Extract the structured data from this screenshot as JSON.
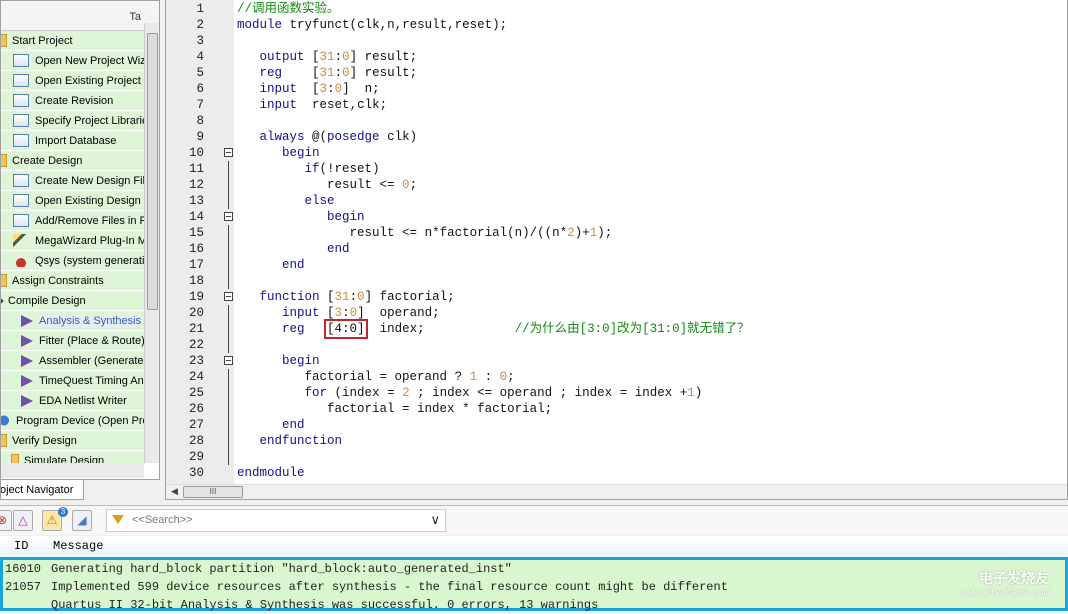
{
  "nav": {
    "header": "Ta",
    "items": [
      {
        "label": "Start Project",
        "level": 0,
        "icon": "folder"
      },
      {
        "label": "Open New Project Wizard",
        "level": 1,
        "icon": "page"
      },
      {
        "label": "Open Existing Project",
        "level": 1,
        "icon": "page"
      },
      {
        "label": "Create Revision",
        "level": 1,
        "icon": "page"
      },
      {
        "label": "Specify Project Libraries",
        "level": 1,
        "icon": "page"
      },
      {
        "label": "Import Database",
        "level": 1,
        "icon": "page"
      },
      {
        "label": "Create Design",
        "level": 0,
        "icon": "folder"
      },
      {
        "label": "Create New Design File",
        "level": 1,
        "icon": "page"
      },
      {
        "label": "Open Existing Design File",
        "level": 1,
        "icon": "page"
      },
      {
        "label": "Add/Remove Files in Project",
        "level": 1,
        "icon": "page"
      },
      {
        "label": "MegaWizard Plug-In Manager",
        "level": 1,
        "icon": "wand"
      },
      {
        "label": "Qsys (system generation)",
        "level": 1,
        "icon": "qsys"
      },
      {
        "label": "Assign Constraints",
        "level": 0,
        "icon": "folder"
      },
      {
        "label": "Compile Design",
        "level": 0,
        "icon": "arrow"
      },
      {
        "label": "Analysis & Synthesis",
        "level": 1,
        "icon": "play",
        "selected": true
      },
      {
        "label": "Fitter (Place & Route)",
        "level": 1,
        "icon": "play"
      },
      {
        "label": "Assembler (Generate programming files)",
        "level": 1,
        "icon": "play"
      },
      {
        "label": "TimeQuest Timing Analysis",
        "level": 1,
        "icon": "play"
      },
      {
        "label": "EDA Netlist Writer",
        "level": 1,
        "icon": "play"
      },
      {
        "label": "Program Device (Open Programmer)",
        "level": 0,
        "icon": "prog"
      },
      {
        "label": "Verify Design",
        "level": 0,
        "icon": "folder"
      },
      {
        "label": "Simulate Design",
        "level": 1,
        "icon": "folder"
      }
    ],
    "tab": "Project Navigator"
  },
  "editor": {
    "highlight": {
      "line": 21,
      "text": "[4:0]"
    },
    "folds": {
      "10": "fold",
      "14": "fold",
      "19": "fold",
      "23": "fold",
      "11": "line",
      "12": "line",
      "13": "line",
      "15": "line",
      "16": "line",
      "17": "line",
      "18": "line",
      "20": "line",
      "21": "line",
      "22": "line",
      "24": "line",
      "25": "line",
      "26": "line",
      "27": "line",
      "28": "line",
      "29": "line"
    },
    "lines": [
      "//调用函数实验。",
      "module tryfunct(clk,n,result,reset);",
      "",
      "   output [31:0] result;",
      "   reg    [31:0] result;",
      "   input  [3:0]  n;",
      "   input  reset,clk;",
      "",
      "   always @(posedge clk)",
      "      begin",
      "         if(!reset)",
      "            result <= 0;",
      "         else",
      "            begin",
      "               result <= n*factorial(n)/((n*2)+1);",
      "            end",
      "      end",
      "",
      "   function [31:0] factorial;",
      "      input [3:0]  operand;",
      "      reg   [4:0]  index;            //为什么由[3:0]改为[31:0]就无错了？",
      "",
      "      begin",
      "         factorial = operand ? 1 : 0;",
      "         for (index = 2 ; index <= operand ; index = index +1)",
      "            factorial = index * factorial;",
      "      end",
      "   endfunction",
      "",
      "endmodule"
    ]
  },
  "messages": {
    "search_placeholder": "<<Search>>",
    "warning_count": "3",
    "col_id": "ID",
    "col_message": "Message",
    "rows": [
      {
        "id": "16010",
        "text": "Generating hard_block partition \"hard_block:auto_generated_inst\""
      },
      {
        "id": "21057",
        "text": "Implemented 599 device resources after synthesis - the final resource count might be different"
      },
      {
        "id": "",
        "text": "Quartus II 32-bit Analysis & Synthesis was successful. 0 errors, 13 warnings"
      }
    ]
  },
  "watermark": {
    "title": "电子发烧友",
    "url": "www.elecfans.com"
  }
}
